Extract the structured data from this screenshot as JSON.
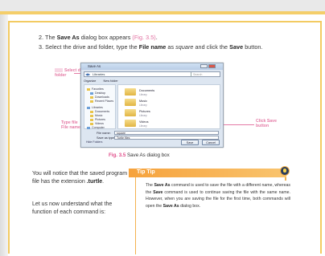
{
  "steps": [
    {
      "num": "2.",
      "pre": "The ",
      "bold1": "Save As",
      "mid": " dialog box appears ",
      "ref": "(Fig. 3.5)",
      "post": "."
    },
    {
      "num": "3.",
      "pre": "Select the drive and folder, type the ",
      "bold1": "File name",
      "mid": " as ",
      "italic": "square",
      "mid2": " and click the ",
      "bold2": "Save",
      "post": " button."
    }
  ],
  "callouts": {
    "left_top": [
      "Select drive",
      "folder"
    ],
    "left_bottom": [
      "Type file",
      "File name"
    ],
    "right": [
      "Click Save",
      "button"
    ]
  },
  "dialog": {
    "title": "Save As",
    "address": "Libraries",
    "search_placeholder": "Search",
    "toolbar": [
      "Organize",
      "New folder"
    ],
    "nav_items": [
      "Favorites",
      "Desktop",
      "Downloads",
      "Recent Places",
      "Libraries",
      "Documents",
      "Music",
      "Pictures",
      "Videos",
      "Computer"
    ],
    "folders": [
      {
        "name": "Documents",
        "sub": "Library"
      },
      {
        "name": "Music",
        "sub": "Library"
      },
      {
        "name": "Pictures",
        "sub": "Library"
      },
      {
        "name": "Videos",
        "sub": "Library"
      }
    ],
    "file_name_label": "File name:",
    "file_name_value": "square",
    "save_type_label": "Save as type:",
    "save_type_value": "Turtle files",
    "hide_folders": "Hide Folders",
    "save_button": "Save",
    "cancel_button": "Cancel"
  },
  "caption": {
    "num": "Fig. 3.5",
    "text": " Save As dialog box"
  },
  "body": {
    "para1_pre": "You will notice that the saved program file has the extension ",
    "para1_bold": ".turtle",
    "para1_post": ".",
    "para2": "Let us now understand what the function of each command is:"
  },
  "tip": {
    "title": "Tip Tip",
    "t1": "The ",
    "b1": "Save As",
    "t2": " command is used to save the file with a different name, whereas the ",
    "b2": "Save",
    "t3": " command is used to continue saving the file with the same name. However, when you are saving the file for the first time, both commands will open the ",
    "b3": "Save As",
    "t4": " dialog box."
  },
  "colors": {
    "accent": "#f3cb62",
    "pink": "#e26fa0",
    "tip_orange": "#f6a23c"
  }
}
